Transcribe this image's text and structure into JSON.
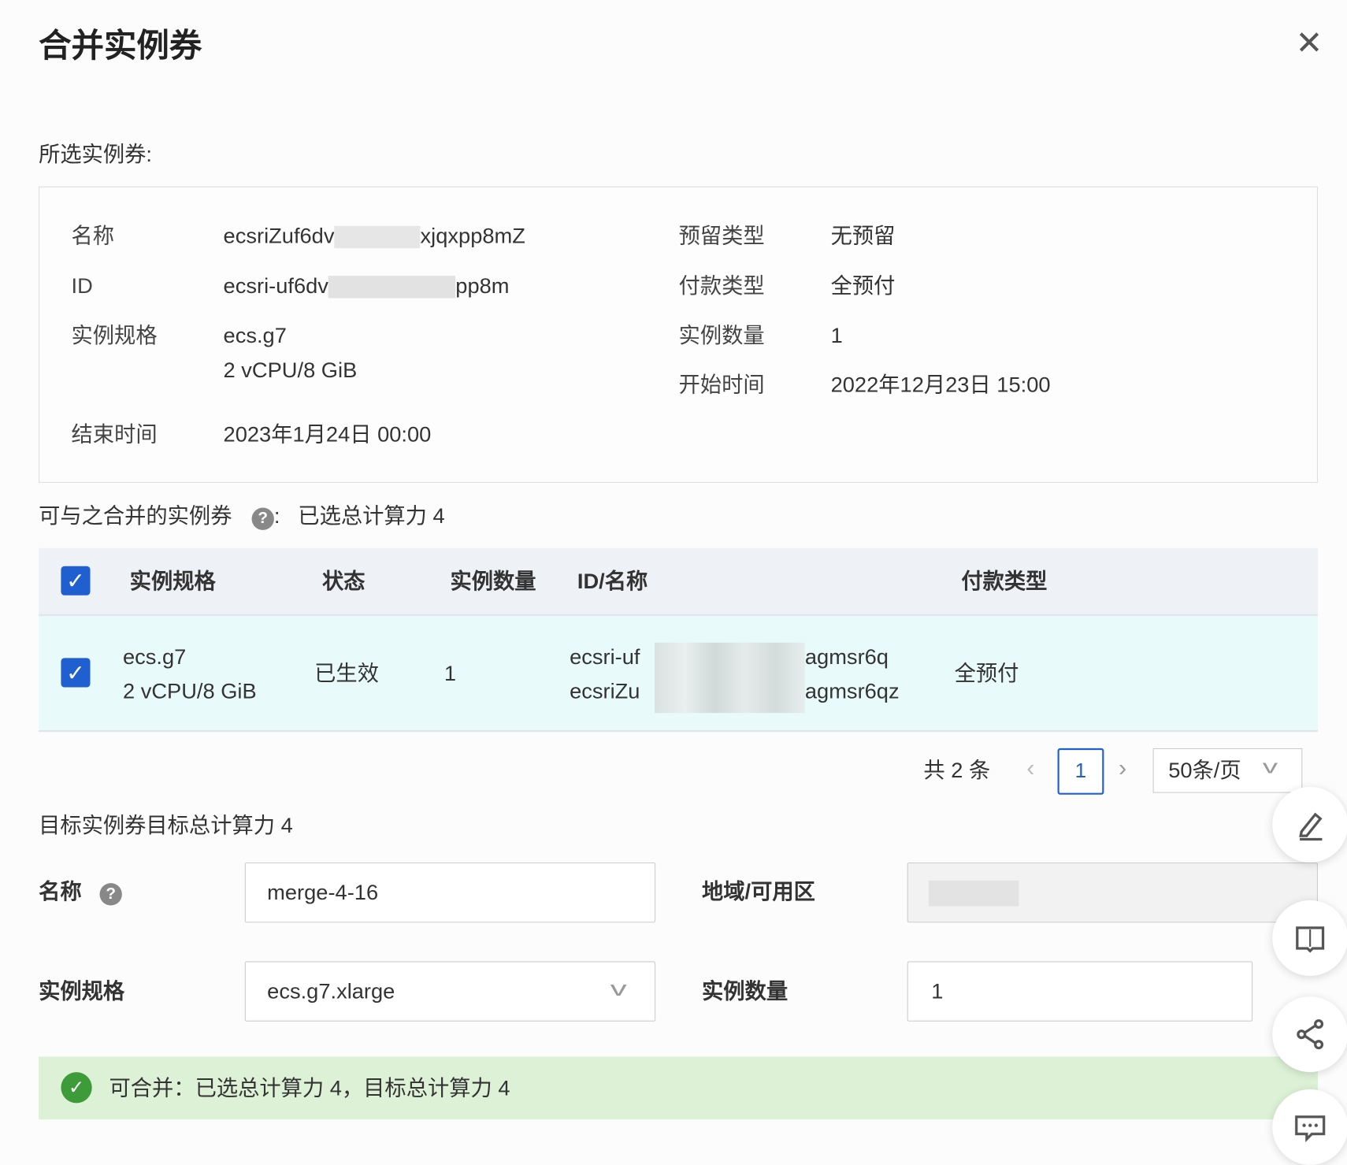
{
  "dialog": {
    "title": "合并实例券",
    "close_icon": "close-icon"
  },
  "selected": {
    "heading": "所选实例券:",
    "left": [
      {
        "label": "名称",
        "value": "ecsriZuf6dv",
        "value_end": "xjqxpp8mZ"
      },
      {
        "label": "ID",
        "value": "ecsri-uf6dv",
        "value_end": "pp8m"
      },
      {
        "label": "实例规格",
        "value": "ecs.g7",
        "value2": "2 vCPU/8 GiB"
      },
      {
        "label": "结束时间",
        "value": "2023年1月24日 00:00"
      }
    ],
    "right": [
      {
        "label": "预留类型",
        "value": "无预留"
      },
      {
        "label": "付款类型",
        "value": "全预付"
      },
      {
        "label": "实例数量",
        "value": "1"
      },
      {
        "label": "开始时间",
        "value": "2022年12月23日 15:00"
      }
    ]
  },
  "mergeable": {
    "heading": "可与之合并的实例券",
    "colon": ":",
    "summary": "已选总计算力  4",
    "columns": [
      "实例规格",
      "状态",
      "实例数量",
      "ID/名称",
      "付款类型"
    ],
    "rows": [
      {
        "spec": "ecs.g7",
        "spec2": "2 vCPU/8 GiB",
        "status": "已生效",
        "count": "1",
        "id_start": "ecsri-uf",
        "id_end": "agmsr6q",
        "name_start": "ecsriZu",
        "name_end": "agmsr6qz",
        "payment": "全预付",
        "checked": true
      }
    ],
    "pagination": {
      "total": "共 2 条",
      "page": "1",
      "page_size": "50条/页"
    }
  },
  "target": {
    "heading": "目标实例券目标总计算力  4",
    "name_label": "名称",
    "name_value": "merge-4-16",
    "region_label": "地域/可用区",
    "spec_label": "实例规格",
    "spec_value": "ecs.g7.xlarge",
    "count_label": "实例数量",
    "count_value": "1"
  },
  "banner": {
    "text": "可合并：已选总计算力 4，目标总计算力 4",
    "color": "#dcf1d6"
  },
  "accent": "#1f5fd0"
}
